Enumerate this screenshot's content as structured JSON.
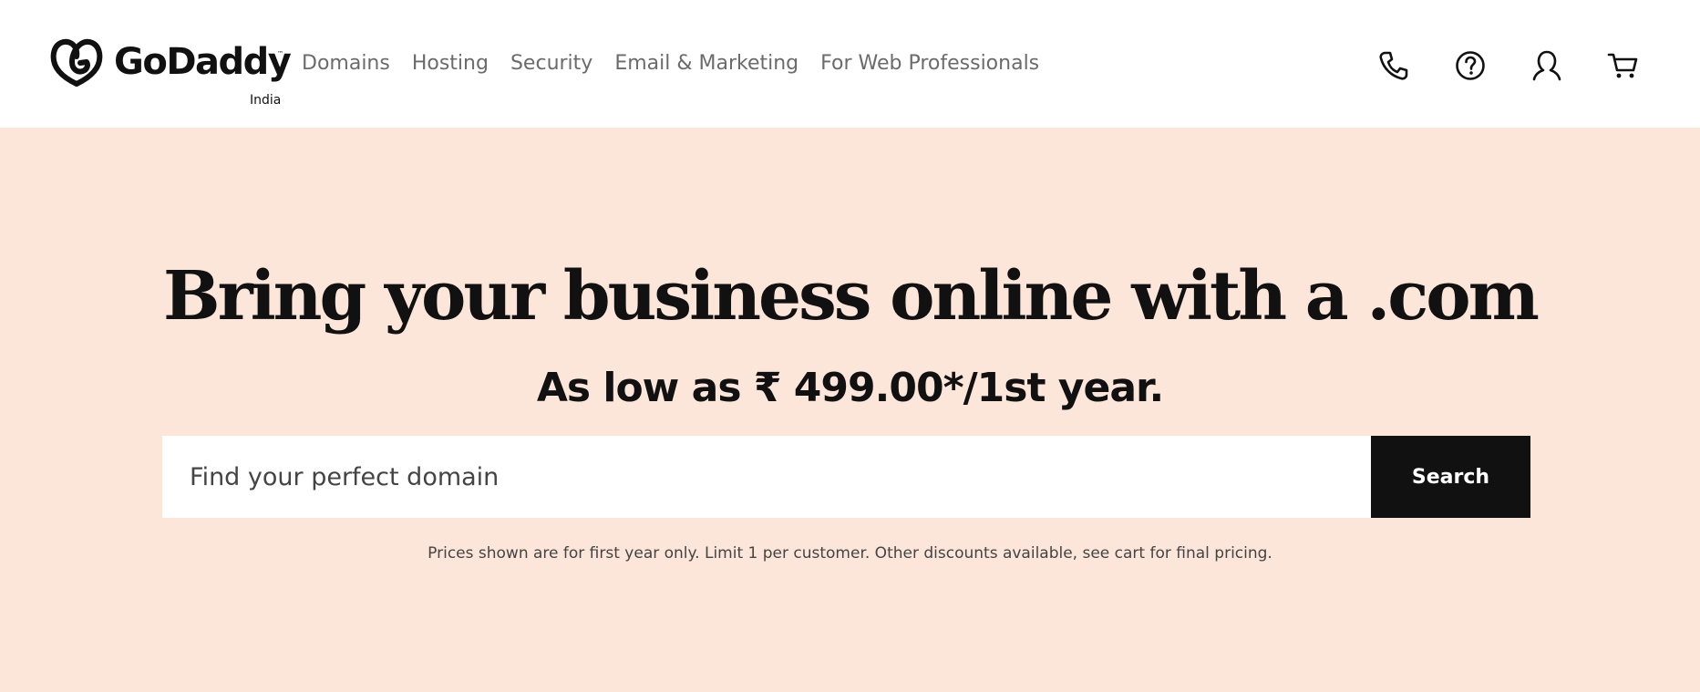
{
  "brand": {
    "name": "GoDaddy",
    "trademark": "™",
    "region": "India",
    "logo_icon": "godaddy-heart-logo"
  },
  "nav": {
    "items": [
      {
        "label": "Domains"
      },
      {
        "label": "Hosting"
      },
      {
        "label": "Security"
      },
      {
        "label": "Email & Marketing"
      },
      {
        "label": "For Web Professionals"
      }
    ]
  },
  "header_icons": [
    "phone-icon",
    "help-icon",
    "account-icon",
    "cart-icon"
  ],
  "hero": {
    "title": "Bring your business online with a .com",
    "subtitle": "As low as ₹ 499.00*/1st year.",
    "background_color": "#fbe6d9"
  },
  "search": {
    "placeholder": "Find your perfect domain",
    "value": "",
    "button_label": "Search"
  },
  "disclaimer": "Prices shown are for first year only. Limit 1 per customer. Other discounts available, see cart for final pricing."
}
